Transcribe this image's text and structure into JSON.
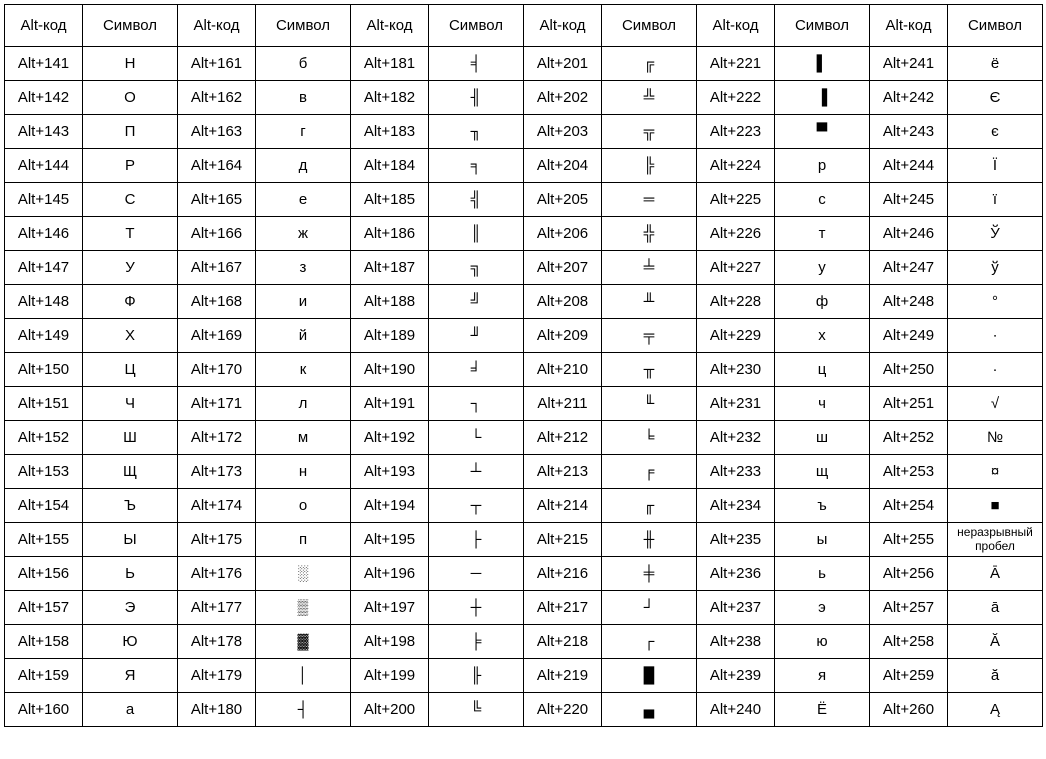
{
  "headers": {
    "code": "Alt-код",
    "symbol": "Символ"
  },
  "columns": [
    [
      {
        "code": "Alt+141",
        "sym": "Н"
      },
      {
        "code": "Alt+142",
        "sym": "О"
      },
      {
        "code": "Alt+143",
        "sym": "П"
      },
      {
        "code": "Alt+144",
        "sym": "Р"
      },
      {
        "code": "Alt+145",
        "sym": "С"
      },
      {
        "code": "Alt+146",
        "sym": "Т"
      },
      {
        "code": "Alt+147",
        "sym": "У"
      },
      {
        "code": "Alt+148",
        "sym": "Ф"
      },
      {
        "code": "Alt+149",
        "sym": "Х"
      },
      {
        "code": "Alt+150",
        "sym": "Ц"
      },
      {
        "code": "Alt+151",
        "sym": "Ч"
      },
      {
        "code": "Alt+152",
        "sym": "Ш"
      },
      {
        "code": "Alt+153",
        "sym": "Щ"
      },
      {
        "code": "Alt+154",
        "sym": "Ъ"
      },
      {
        "code": "Alt+155",
        "sym": "Ы"
      },
      {
        "code": "Alt+156",
        "sym": "Ь"
      },
      {
        "code": "Alt+157",
        "sym": "Э"
      },
      {
        "code": "Alt+158",
        "sym": "Ю"
      },
      {
        "code": "Alt+159",
        "sym": "Я"
      },
      {
        "code": "Alt+160",
        "sym": "а"
      }
    ],
    [
      {
        "code": "Alt+161",
        "sym": "б"
      },
      {
        "code": "Alt+162",
        "sym": "в"
      },
      {
        "code": "Alt+163",
        "sym": "г"
      },
      {
        "code": "Alt+164",
        "sym": "д"
      },
      {
        "code": "Alt+165",
        "sym": "е"
      },
      {
        "code": "Alt+166",
        "sym": "ж"
      },
      {
        "code": "Alt+167",
        "sym": "з"
      },
      {
        "code": "Alt+168",
        "sym": "и"
      },
      {
        "code": "Alt+169",
        "sym": "й"
      },
      {
        "code": "Alt+170",
        "sym": "к"
      },
      {
        "code": "Alt+171",
        "sym": "л"
      },
      {
        "code": "Alt+172",
        "sym": "м"
      },
      {
        "code": "Alt+173",
        "sym": "н"
      },
      {
        "code": "Alt+174",
        "sym": "о"
      },
      {
        "code": "Alt+175",
        "sym": "п"
      },
      {
        "code": "Alt+176",
        "sym": "░"
      },
      {
        "code": "Alt+177",
        "sym": "▒"
      },
      {
        "code": "Alt+178",
        "sym": "▓"
      },
      {
        "code": "Alt+179",
        "sym": "│"
      },
      {
        "code": "Alt+180",
        "sym": "┤"
      }
    ],
    [
      {
        "code": "Alt+181",
        "sym": "╡"
      },
      {
        "code": "Alt+182",
        "sym": "╢"
      },
      {
        "code": "Alt+183",
        "sym": "╖"
      },
      {
        "code": "Alt+184",
        "sym": "╕"
      },
      {
        "code": "Alt+185",
        "sym": "╣"
      },
      {
        "code": "Alt+186",
        "sym": "║"
      },
      {
        "code": "Alt+187",
        "sym": "╗"
      },
      {
        "code": "Alt+188",
        "sym": "╝"
      },
      {
        "code": "Alt+189",
        "sym": "╜"
      },
      {
        "code": "Alt+190",
        "sym": "╛"
      },
      {
        "code": "Alt+191",
        "sym": "┐"
      },
      {
        "code": "Alt+192",
        "sym": "└"
      },
      {
        "code": "Alt+193",
        "sym": "┴"
      },
      {
        "code": "Alt+194",
        "sym": "┬"
      },
      {
        "code": "Alt+195",
        "sym": "├"
      },
      {
        "code": "Alt+196",
        "sym": "─"
      },
      {
        "code": "Alt+197",
        "sym": "┼"
      },
      {
        "code": "Alt+198",
        "sym": "╞"
      },
      {
        "code": "Alt+199",
        "sym": "╟"
      },
      {
        "code": "Alt+200",
        "sym": "╚"
      }
    ],
    [
      {
        "code": "Alt+201",
        "sym": "╔"
      },
      {
        "code": "Alt+202",
        "sym": "╩"
      },
      {
        "code": "Alt+203",
        "sym": "╦"
      },
      {
        "code": "Alt+204",
        "sym": "╠"
      },
      {
        "code": "Alt+205",
        "sym": "═"
      },
      {
        "code": "Alt+206",
        "sym": "╬"
      },
      {
        "code": "Alt+207",
        "sym": "╧"
      },
      {
        "code": "Alt+208",
        "sym": "╨"
      },
      {
        "code": "Alt+209",
        "sym": "╤"
      },
      {
        "code": "Alt+210",
        "sym": "╥"
      },
      {
        "code": "Alt+211",
        "sym": "╙"
      },
      {
        "code": "Alt+212",
        "sym": "╘"
      },
      {
        "code": "Alt+213",
        "sym": "╒"
      },
      {
        "code": "Alt+214",
        "sym": "╓"
      },
      {
        "code": "Alt+215",
        "sym": "╫"
      },
      {
        "code": "Alt+216",
        "sym": "╪"
      },
      {
        "code": "Alt+217",
        "sym": "┘"
      },
      {
        "code": "Alt+218",
        "sym": "┌"
      },
      {
        "code": "Alt+219",
        "sym": "█"
      },
      {
        "code": "Alt+220",
        "sym": "▄"
      }
    ],
    [
      {
        "code": "Alt+221",
        "sym": "▌"
      },
      {
        "code": "Alt+222",
        "sym": "▐"
      },
      {
        "code": "Alt+223",
        "sym": "▀"
      },
      {
        "code": "Alt+224",
        "sym": "р"
      },
      {
        "code": "Alt+225",
        "sym": "с"
      },
      {
        "code": "Alt+226",
        "sym": "т"
      },
      {
        "code": "Alt+227",
        "sym": "у"
      },
      {
        "code": "Alt+228",
        "sym": "ф"
      },
      {
        "code": "Alt+229",
        "sym": "х"
      },
      {
        "code": "Alt+230",
        "sym": "ц"
      },
      {
        "code": "Alt+231",
        "sym": "ч"
      },
      {
        "code": "Alt+232",
        "sym": "ш"
      },
      {
        "code": "Alt+233",
        "sym": "щ"
      },
      {
        "code": "Alt+234",
        "sym": "ъ"
      },
      {
        "code": "Alt+235",
        "sym": "ы"
      },
      {
        "code": "Alt+236",
        "sym": "ь"
      },
      {
        "code": "Alt+237",
        "sym": "э"
      },
      {
        "code": "Alt+238",
        "sym": "ю"
      },
      {
        "code": "Alt+239",
        "sym": "я"
      },
      {
        "code": "Alt+240",
        "sym": "Ё"
      }
    ],
    [
      {
        "code": "Alt+241",
        "sym": "ё"
      },
      {
        "code": "Alt+242",
        "sym": "Є"
      },
      {
        "code": "Alt+243",
        "sym": "є"
      },
      {
        "code": "Alt+244",
        "sym": "Ї"
      },
      {
        "code": "Alt+245",
        "sym": "ї"
      },
      {
        "code": "Alt+246",
        "sym": "Ў"
      },
      {
        "code": "Alt+247",
        "sym": "ў"
      },
      {
        "code": "Alt+248",
        "sym": "°"
      },
      {
        "code": "Alt+249",
        "sym": "∙"
      },
      {
        "code": "Alt+250",
        "sym": "·"
      },
      {
        "code": "Alt+251",
        "sym": "√"
      },
      {
        "code": "Alt+252",
        "sym": "№"
      },
      {
        "code": "Alt+253",
        "sym": "¤"
      },
      {
        "code": "Alt+254",
        "sym": "■"
      },
      {
        "code": "Alt+255",
        "sym": "неразрывный пробел",
        "small": true
      },
      {
        "code": "Alt+256",
        "sym": "Ā"
      },
      {
        "code": "Alt+257",
        "sym": "ā"
      },
      {
        "code": "Alt+258",
        "sym": "Ă"
      },
      {
        "code": "Alt+259",
        "sym": "ă"
      },
      {
        "code": "Alt+260",
        "sym": "Ą"
      }
    ]
  ]
}
